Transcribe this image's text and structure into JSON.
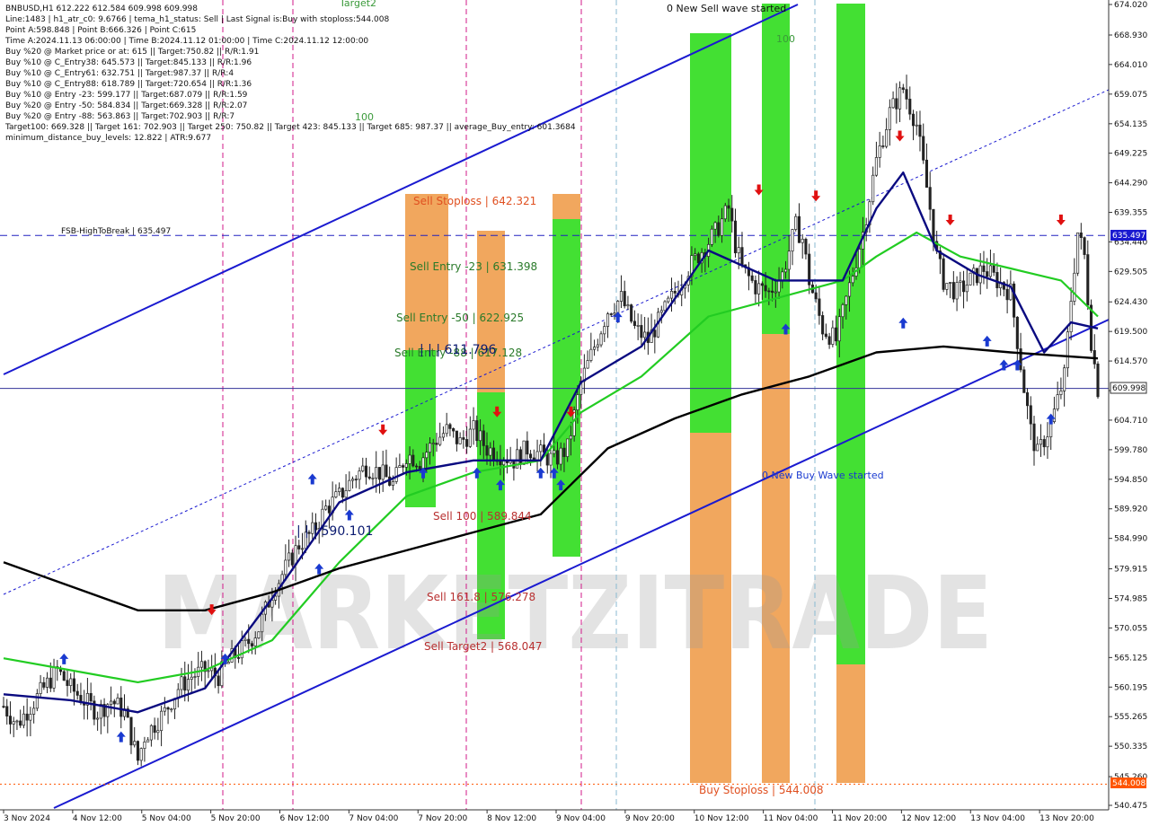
{
  "info_lines": [
    "BNBUSD,H1  612.222 612.584 609.998 609.998",
    "Line:1483 | h1_atr_c0: 9.6766 | tema_h1_status: Sell | Last Signal is:Buy with stoploss:544.008",
    "Point A:598.848 | Point B:666.326 | Point C:615",
    "Time A:2024.11.13 06:00:00 | Time B:2024.11.12 01:00:00 | Time C:2024.11.12 12:00:00",
    "Buy %20 @ Market price or at: 615 || Target:750.82 || R/R:1.91",
    "Buy %10 @ C_Entry38: 645.573 || Target:845.133 || R/R:1.96",
    "Buy %10 @ C_Entry61: 632.751 || Target:987.37 || R/R:4",
    "Buy %10 @ C_Entry88: 618.789 || Target:720.654 || R/R:1.36",
    "Buy %10 @ Entry -23: 599.177 || Target:687.079 || R/R:1.59",
    "Buy %20 @ Entry -50: 584.834 || Target:669.328 || R/R:2.07",
    "Buy %20 @ Entry -88: 563.863 || Target:702.903 || R/R:7",
    "Target100: 669.328 || Target 161: 702.903 || Target 250: 750.82 || Target 423: 845.133 || Target 685: 987.37 || average_Buy_entry: 601.3684",
    "minimum_distance_buy_levels: 12.822 | ATR:9.677"
  ],
  "chart_data": {
    "type": "candlestick",
    "symbol": "BNBUSD",
    "timeframe": "H1",
    "ylim": [
      540.475,
      674.02
    ],
    "y_ticks": [
      674.02,
      668.93,
      664.01,
      659.075,
      654.135,
      649.225,
      644.29,
      639.355,
      634.44,
      629.505,
      624.43,
      619.5,
      614.57,
      609.635,
      604.71,
      599.78,
      594.85,
      589.92,
      584.99,
      579.915,
      574.985,
      570.055,
      565.125,
      560.195,
      555.265,
      550.335,
      545.26,
      540.475
    ],
    "x_labels": [
      "3 Nov 2024",
      "4 Nov 12:00",
      "5 Nov 04:00",
      "5 Nov 20:00",
      "6 Nov 12:00",
      "7 Nov 04:00",
      "7 Nov 20:00",
      "8 Nov 12:00",
      "9 Nov 04:00",
      "9 Nov 20:00",
      "10 Nov 12:00",
      "11 Nov 04:00",
      "11 Nov 20:00",
      "12 Nov 12:00",
      "13 Nov 04:00",
      "13 Nov 20:00"
    ],
    "current_price": 609.998,
    "current_price_label": "609.998",
    "hline_label": "635.497",
    "buy_stop_label": "544.008",
    "close_path": [
      [
        0,
        557
      ],
      [
        4,
        554
      ],
      [
        8,
        557
      ],
      [
        12,
        560
      ],
      [
        16,
        563
      ],
      [
        20,
        560
      ],
      [
        24,
        558
      ],
      [
        28,
        556
      ],
      [
        32,
        558
      ],
      [
        36,
        556
      ],
      [
        40,
        548
      ],
      [
        42,
        552
      ],
      [
        45,
        554
      ],
      [
        48,
        556
      ],
      [
        52,
        560
      ],
      [
        56,
        562
      ],
      [
        60,
        563
      ],
      [
        64,
        562
      ],
      [
        68,
        565
      ],
      [
        72,
        567
      ],
      [
        76,
        570
      ],
      [
        80,
        576
      ],
      [
        84,
        580
      ],
      [
        88,
        584
      ],
      [
        92,
        586
      ],
      [
        96,
        590
      ],
      [
        100,
        592
      ],
      [
        104,
        595
      ],
      [
        108,
        597
      ],
      [
        112,
        596
      ],
      [
        116,
        594
      ],
      [
        120,
        599
      ],
      [
        124,
        598
      ],
      [
        128,
        601
      ],
      [
        132,
        603
      ],
      [
        136,
        601
      ],
      [
        140,
        603
      ],
      [
        144,
        600
      ],
      [
        148,
        599
      ],
      [
        152,
        598
      ],
      [
        156,
        600
      ],
      [
        160,
        599
      ],
      [
        164,
        598
      ],
      [
        168,
        600
      ],
      [
        172,
        611
      ],
      [
        176,
        617
      ],
      [
        180,
        623
      ],
      [
        184,
        625
      ],
      [
        188,
        620
      ],
      [
        192,
        618
      ],
      [
        196,
        622
      ],
      [
        200,
        626
      ],
      [
        204,
        630
      ],
      [
        208,
        633
      ],
      [
        212,
        636
      ],
      [
        214,
        638
      ],
      [
        216,
        640
      ],
      [
        218,
        634
      ],
      [
        220,
        630
      ],
      [
        224,
        627
      ],
      [
        228,
        626
      ],
      [
        232,
        629
      ],
      [
        236,
        637
      ],
      [
        238,
        635
      ],
      [
        240,
        628
      ],
      [
        244,
        620
      ],
      [
        248,
        618
      ],
      [
        252,
        627
      ],
      [
        256,
        636
      ],
      [
        260,
        648
      ],
      [
        264,
        656
      ],
      [
        268,
        660
      ],
      [
        272,
        654
      ],
      [
        276,
        640
      ],
      [
        278,
        632
      ],
      [
        280,
        628
      ],
      [
        284,
        626
      ],
      [
        288,
        628
      ],
      [
        292,
        630
      ],
      [
        296,
        628
      ],
      [
        300,
        626
      ],
      [
        304,
        610
      ],
      [
        306,
        603
      ],
      [
        308,
        599
      ],
      [
        312,
        604
      ],
      [
        316,
        612
      ],
      [
        318,
        625
      ],
      [
        320,
        636
      ],
      [
        322,
        632
      ],
      [
        324,
        618
      ],
      [
        326,
        610
      ]
    ],
    "series": [
      {
        "name": "",
        "color": "#22cc22",
        "values": [
          [
            0,
            565
          ],
          [
            20,
            563
          ],
          [
            40,
            561
          ],
          [
            60,
            563
          ],
          [
            80,
            568
          ],
          [
            100,
            581
          ],
          [
            120,
            592
          ],
          [
            140,
            596
          ],
          [
            160,
            598
          ],
          [
            172,
            606
          ],
          [
            190,
            612
          ],
          [
            210,
            622
          ],
          [
            230,
            625
          ],
          [
            250,
            628
          ],
          [
            260,
            632
          ],
          [
            272,
            636
          ],
          [
            285,
            632
          ],
          [
            300,
            630
          ],
          [
            315,
            628
          ],
          [
            326,
            622
          ]
        ]
      },
      {
        "name": "",
        "color": "#0a0a80",
        "values": [
          [
            0,
            559
          ],
          [
            20,
            558
          ],
          [
            40,
            556
          ],
          [
            60,
            560
          ],
          [
            80,
            575
          ],
          [
            100,
            591
          ],
          [
            120,
            596
          ],
          [
            140,
            598
          ],
          [
            160,
            598
          ],
          [
            172,
            611
          ],
          [
            190,
            617
          ],
          [
            210,
            633
          ],
          [
            230,
            628
          ],
          [
            250,
            628
          ],
          [
            260,
            640
          ],
          [
            268,
            646
          ],
          [
            278,
            633
          ],
          [
            290,
            629
          ],
          [
            300,
            627
          ],
          [
            310,
            616
          ],
          [
            318,
            621
          ],
          [
            326,
            620
          ]
        ]
      },
      {
        "name": "",
        "color": "#000000",
        "values": [
          [
            0,
            581
          ],
          [
            20,
            577
          ],
          [
            40,
            573
          ],
          [
            60,
            573
          ],
          [
            80,
            576
          ],
          [
            100,
            580
          ],
          [
            120,
            583
          ],
          [
            140,
            586
          ],
          [
            160,
            589
          ],
          [
            180,
            600
          ],
          [
            200,
            605
          ],
          [
            220,
            609
          ],
          [
            240,
            612
          ],
          [
            260,
            616
          ],
          [
            280,
            617
          ],
          [
            300,
            616
          ],
          [
            326,
            615
          ]
        ]
      }
    ],
    "annotations": [
      {
        "text": "Sell Stoploss | 642.321",
        "color": "#e05020"
      },
      {
        "text": "Sell Entry -23 | 631.398",
        "color": "#2a7a2a"
      },
      {
        "text": "Sell Entry -50 | 622.925",
        "color": "#2a7a2a"
      },
      {
        "text": "Sell Entry -88 | 617.128",
        "color": "#2a7a2a"
      },
      {
        "text": "| | | 611.796",
        "color": "#0a1a70"
      },
      {
        "text": "| | | 590.101",
        "color": "#0a1a70"
      },
      {
        "text": "Sell 100 | 589.844",
        "color": "#b83030"
      },
      {
        "text": "Sell 161.8 | 576.278",
        "color": "#b83030"
      },
      {
        "text": "Sell Target2 | 568.047",
        "color": "#b83030"
      },
      {
        "text": "Buy Stoploss | 544.008",
        "color": "#e05020"
      },
      {
        "text": "FSB-HighToBreak | 635.497",
        "color": "#111111"
      },
      {
        "text": "0 New Sell wave started",
        "color": "#111111"
      },
      {
        "text": "0 New Buy Wave started",
        "color": "#1a3ad0"
      },
      {
        "text": "100",
        "color": "#3a9a3a"
      },
      {
        "text": "100",
        "color": "#3a9a3a"
      },
      {
        "text": "Target2",
        "color": "#3a9a3a"
      }
    ],
    "watermark": "MARKETZITRADE"
  },
  "colors": {
    "green_zone": "#33dd22",
    "orange_zone": "#f0a050",
    "channel": "#1a1ad0",
    "hline": "#2020c0",
    "current_line": "#333399",
    "label_bg": "#1a1ad0",
    "buystop_bg": "#ff5500"
  }
}
